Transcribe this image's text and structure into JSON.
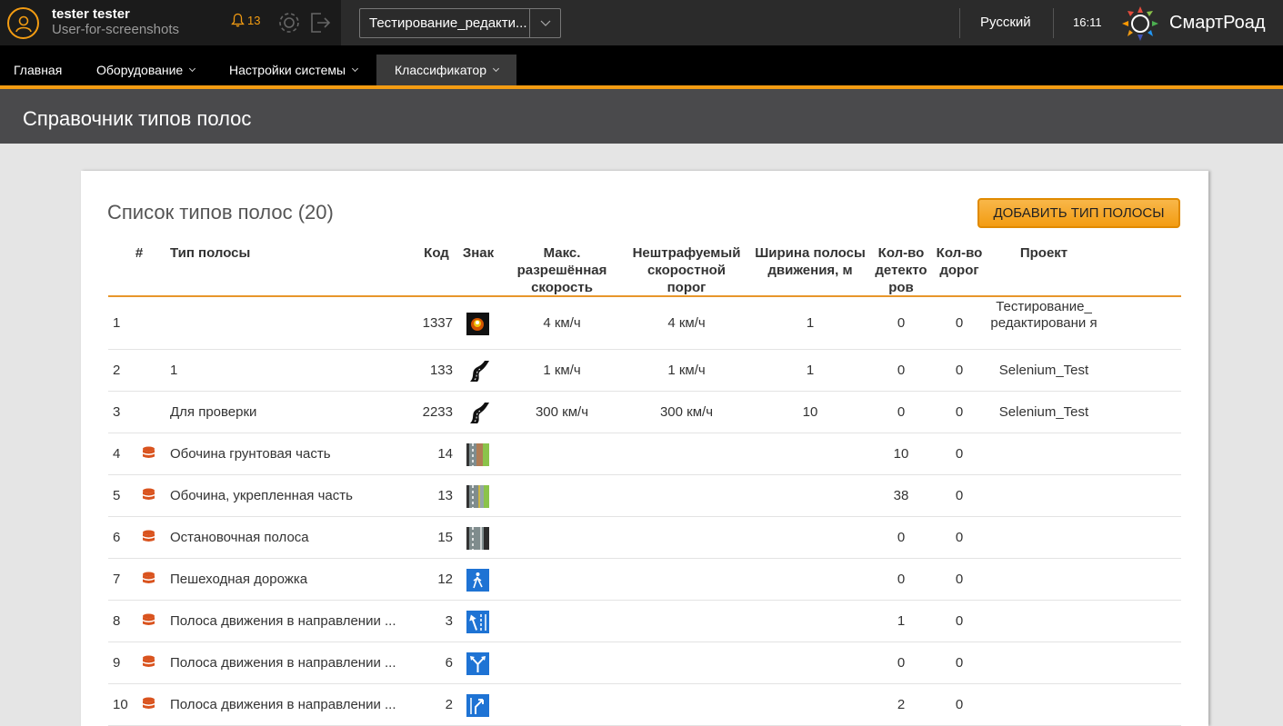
{
  "topbar": {
    "user_name": "tester tester",
    "user_login": "User-for-screenshots",
    "notifications_count": "13",
    "project": "Тестирование_редакти...",
    "language": "Русский",
    "time": "16:11",
    "brand": "СмартРоад"
  },
  "nav": {
    "items": [
      {
        "label": "Главная"
      },
      {
        "label": "Оборудование"
      },
      {
        "label": "Настройки системы"
      },
      {
        "label": "Классификатор"
      }
    ]
  },
  "page": {
    "title": "Справочник типов полос"
  },
  "list": {
    "title": "Список типов полос (20)",
    "add_button": "ДОБАВИТЬ ТИП ПОЛОСЫ",
    "columns": {
      "num": "#",
      "type": "Тип полосы",
      "code": "Код",
      "sign": "Знак",
      "max_speed": "Макс. разрешённая скорость",
      "fine_threshold": "Нештрафуемый скоростной порог",
      "width": "Ширина полосы движения, м",
      "detectors": "Кол-во детекто ров",
      "roads": "Кол-во дорог",
      "project": "Проект"
    },
    "rows": [
      {
        "num": "1",
        "type": "",
        "code": "1337",
        "max_speed": "4 км/ч",
        "fine": "4 км/ч",
        "width": "1",
        "detectors": "0",
        "roads": "0",
        "project": "Тестирование_ редактировани я"
      },
      {
        "num": "2",
        "type": "1",
        "code": "133",
        "max_speed": "1 км/ч",
        "fine": "1 км/ч",
        "width": "1",
        "detectors": "0",
        "roads": "0",
        "project": "Selenium_Test"
      },
      {
        "num": "3",
        "type": "Для проверки",
        "code": "2233",
        "max_speed": "300 км/ч",
        "fine": "300 км/ч",
        "width": "10",
        "detectors": "0",
        "roads": "0",
        "project": "Selenium_Test"
      },
      {
        "num": "4",
        "type": "Обочина грунтовая часть",
        "code": "14",
        "max_speed": "",
        "fine": "",
        "width": "",
        "detectors": "10",
        "roads": "0",
        "project": ""
      },
      {
        "num": "5",
        "type": "Обочина, укрепленная часть",
        "code": "13",
        "max_speed": "",
        "fine": "",
        "width": "",
        "detectors": "38",
        "roads": "0",
        "project": ""
      },
      {
        "num": "6",
        "type": "Остановочная полоса",
        "code": "15",
        "max_speed": "",
        "fine": "",
        "width": "",
        "detectors": "0",
        "roads": "0",
        "project": ""
      },
      {
        "num": "7",
        "type": "Пешеходная дорожка",
        "code": "12",
        "max_speed": "",
        "fine": "",
        "width": "",
        "detectors": "0",
        "roads": "0",
        "project": ""
      },
      {
        "num": "8",
        "type": "Полоса движения в направлении ...",
        "code": "3",
        "max_speed": "",
        "fine": "",
        "width": "",
        "detectors": "1",
        "roads": "0",
        "project": ""
      },
      {
        "num": "9",
        "type": "Полоса движения в направлении ...",
        "code": "6",
        "max_speed": "",
        "fine": "",
        "width": "",
        "detectors": "0",
        "roads": "0",
        "project": ""
      },
      {
        "num": "10",
        "type": "Полоса движения в направлении ...",
        "code": "2",
        "max_speed": "",
        "fine": "",
        "width": "",
        "detectors": "2",
        "roads": "0",
        "project": ""
      }
    ]
  }
}
